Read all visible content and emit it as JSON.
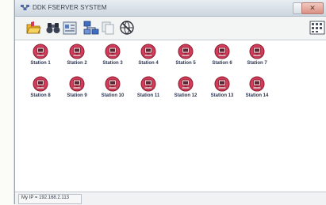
{
  "window": {
    "title": "DDK FSERVER SYSTEM"
  },
  "toolbar": {
    "buttons": [
      {
        "icon": "folder-open-icon"
      },
      {
        "icon": "binoculars-icon"
      },
      {
        "icon": "properties-icon"
      },
      {
        "icon": "network-icon"
      },
      {
        "icon": "copy-icon"
      },
      {
        "icon": "globe-disabled-icon"
      },
      {
        "icon": "view-grid-icon"
      }
    ]
  },
  "stations": [
    {
      "label": "Station 1"
    },
    {
      "label": "Station 2"
    },
    {
      "label": "Station 3"
    },
    {
      "label": "Station 4"
    },
    {
      "label": "Station 5"
    },
    {
      "label": "Station 6"
    },
    {
      "label": "Station 7"
    },
    {
      "label": "Station 8"
    },
    {
      "label": "Station 9"
    },
    {
      "label": "Station 10"
    },
    {
      "label": "Station 11"
    },
    {
      "label": "Station 12"
    },
    {
      "label": "Station 13"
    },
    {
      "label": "Station 14"
    }
  ],
  "statusbar": {
    "ip_text": "My IP = 192.168.2.113"
  },
  "colors": {
    "station_icon": "#d23b5a",
    "station_icon_dark": "#8b1c2e",
    "label_text": "#2b3550"
  }
}
